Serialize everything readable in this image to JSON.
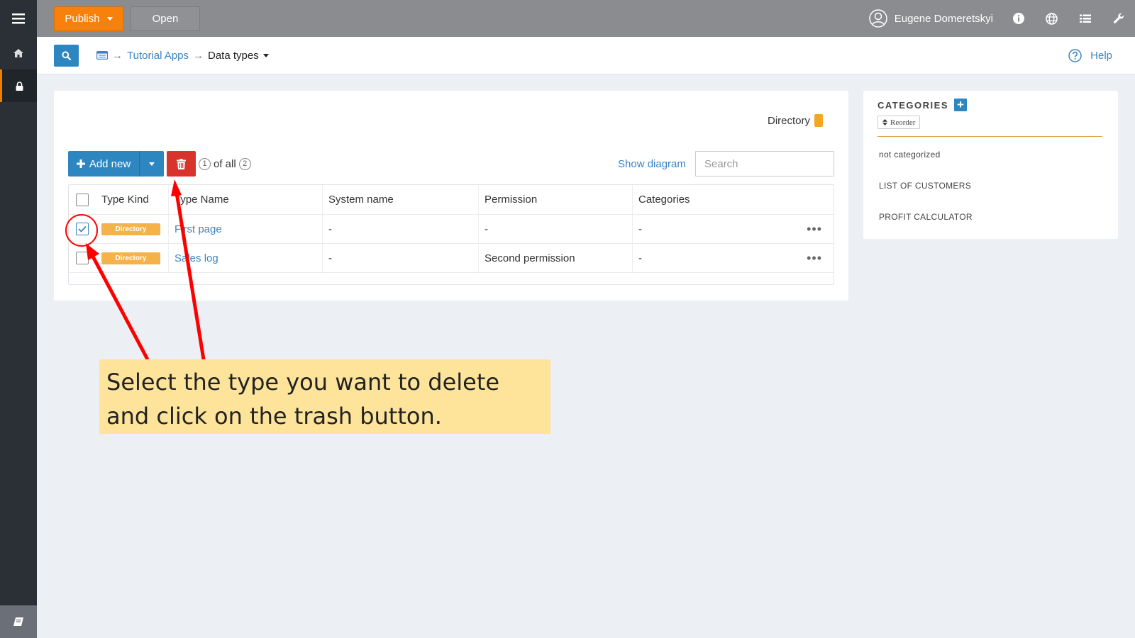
{
  "topbar": {
    "publish_label": "Publish",
    "open_label": "Open",
    "user_name": "Eugene Domeretskyi"
  },
  "subbar": {
    "breadcrumb": [
      "Tutorial Apps",
      "Data types"
    ],
    "help_label": "Help"
  },
  "panel": {
    "legend_label": "Directory",
    "legend_color": "#f5a623",
    "add_new_label": "Add new",
    "counter_selected": "1",
    "counter_text": "of all",
    "counter_total": "2",
    "show_diagram_label": "Show diagram",
    "search_placeholder": "Search"
  },
  "table": {
    "headers": {
      "kind": "Type Kind",
      "name": "Type Name",
      "system": "System name",
      "permission": "Permission",
      "categories": "Categories"
    },
    "rows": [
      {
        "checked": true,
        "kind": "Directory",
        "name": "First page",
        "system": "-",
        "permission": "-",
        "categories": "-"
      },
      {
        "checked": false,
        "kind": "Directory",
        "name": "Sales log",
        "system": "-",
        "permission": "Second permission",
        "categories": "-"
      }
    ]
  },
  "categories": {
    "title": "CATEGORIES",
    "reorder_label": "Reorder",
    "items": [
      "not categorized",
      "LIST OF CUSTOMERS",
      "PROFIT CALCULATOR"
    ]
  },
  "annotation": {
    "callout_line1": "Select the type you want to delete",
    "callout_line2": "and click on the trash button.",
    "arrow_color": "#ff0000",
    "callout_color": "#fde49a"
  },
  "colors": {
    "accent": "#2e86c1",
    "publish": "#f7810a",
    "trash": "#d9342b",
    "badge": "#f5b24a"
  }
}
